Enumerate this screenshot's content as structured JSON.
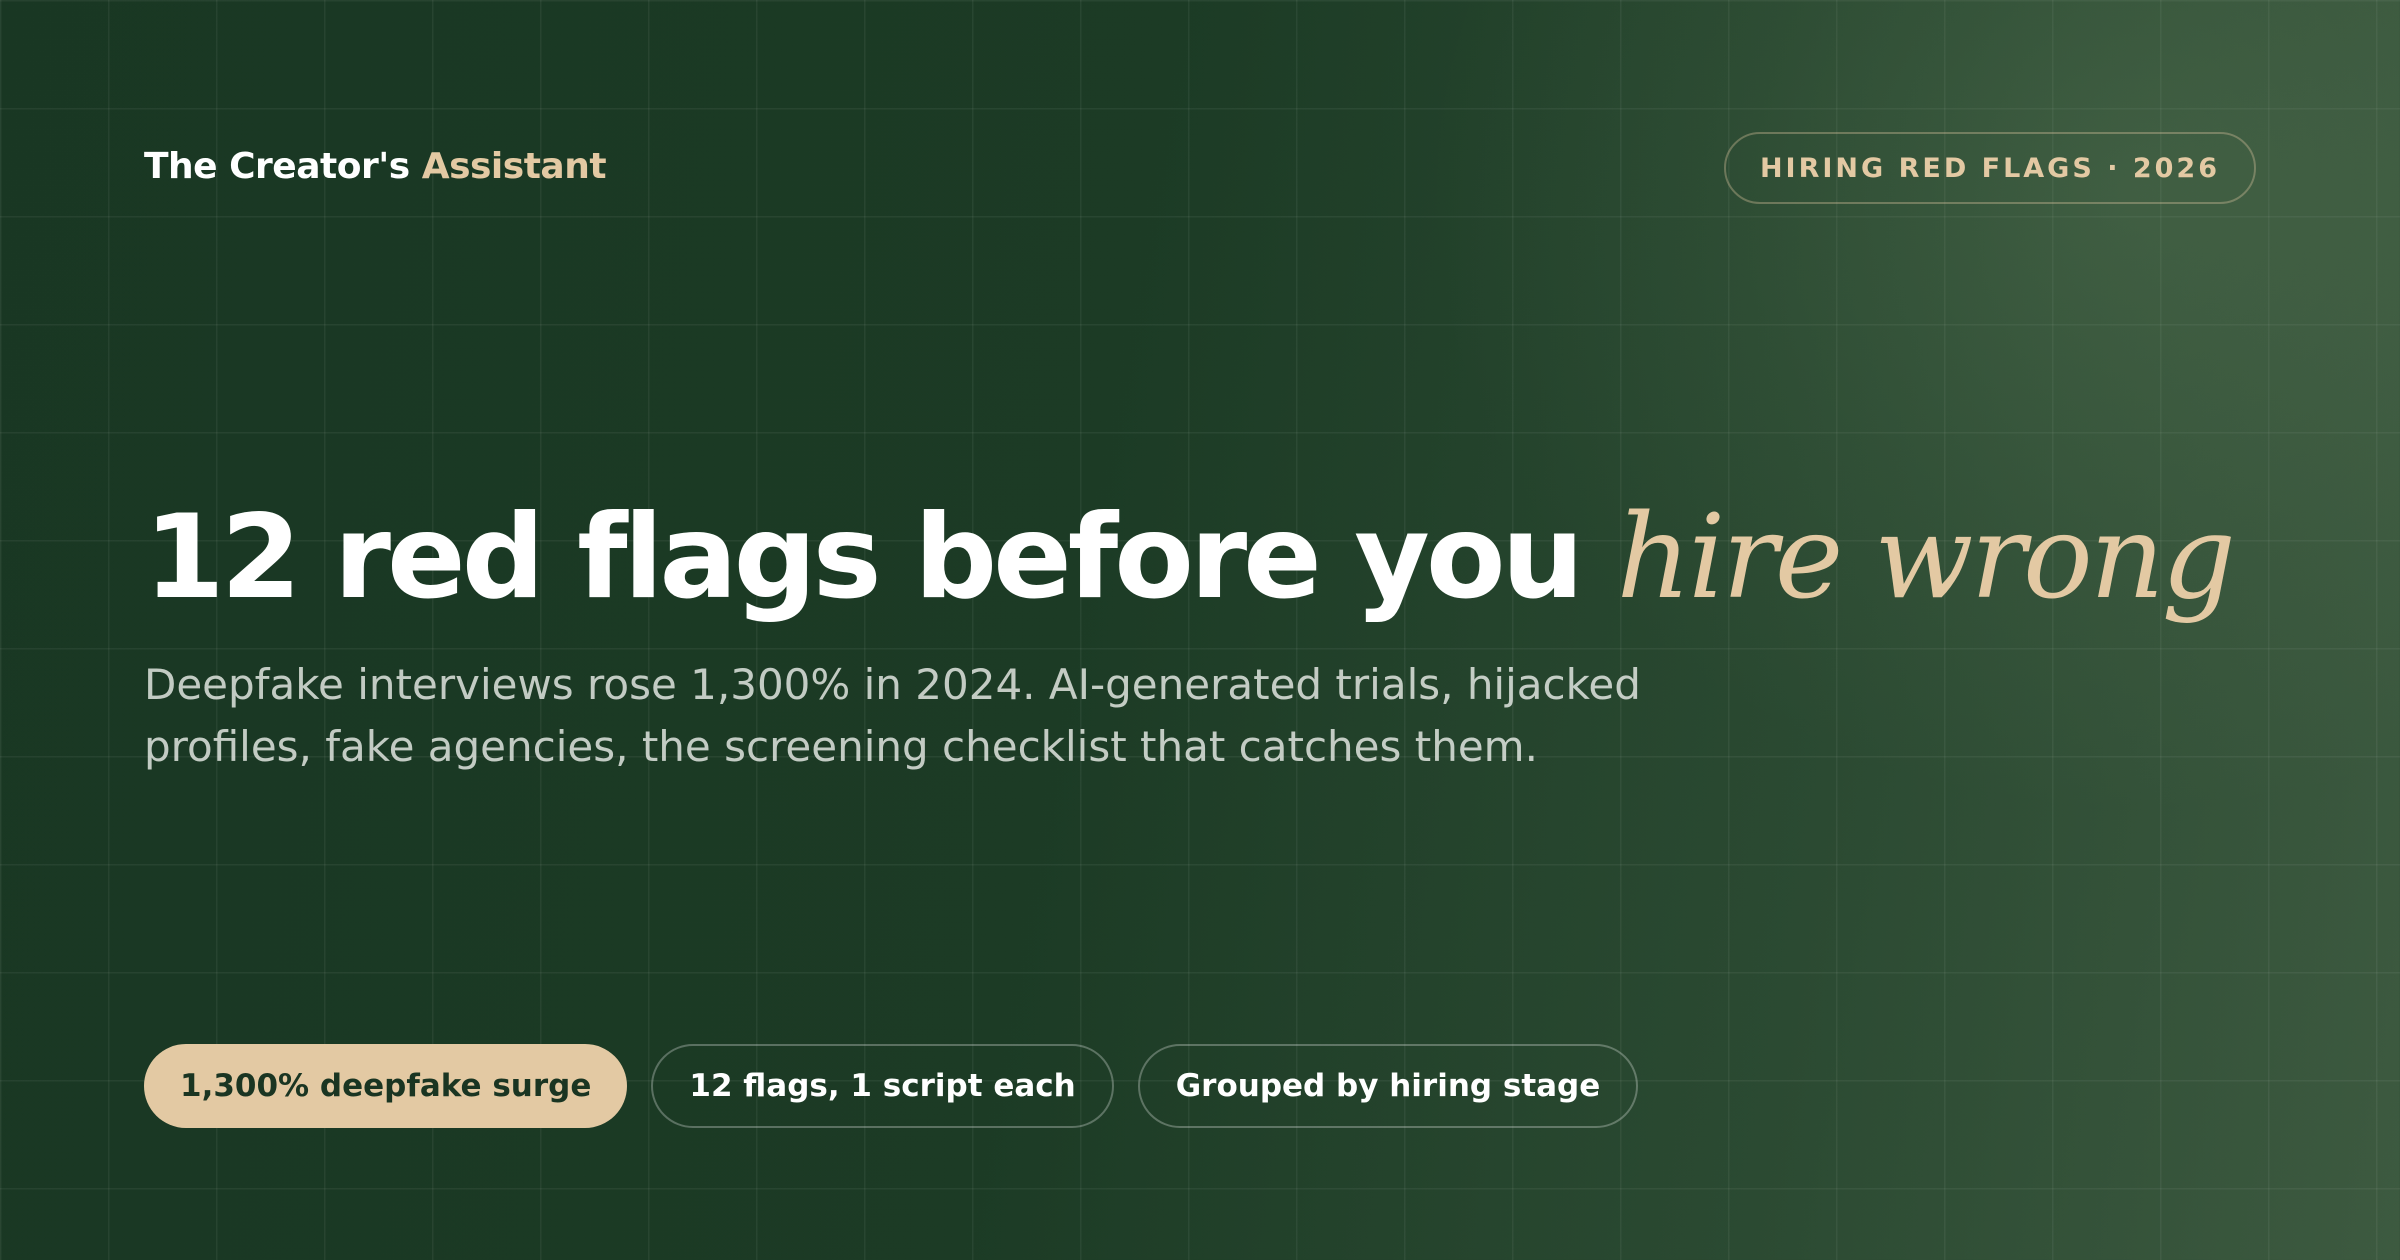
{
  "brand": {
    "name": "The Creator's",
    "accent": "Assistant"
  },
  "tag": "HIRING RED FLAGS · 2026",
  "headline": {
    "main": "12 red flags before you",
    "accent": "hire wrong"
  },
  "subtitle": "Deepfake interviews rose 1,300% in 2024. AI-generated trials, hijacked profiles, fake agencies, the screening checklist that catches them.",
  "chips": [
    {
      "label": "1,300% deepfake surge"
    },
    {
      "label": "12 flags, 1 script each"
    },
    {
      "label": "Grouped by hiring stage"
    }
  ],
  "colors": {
    "background": "#1c3b25",
    "accent": "#e3c9a3",
    "text": "#ffffff"
  }
}
